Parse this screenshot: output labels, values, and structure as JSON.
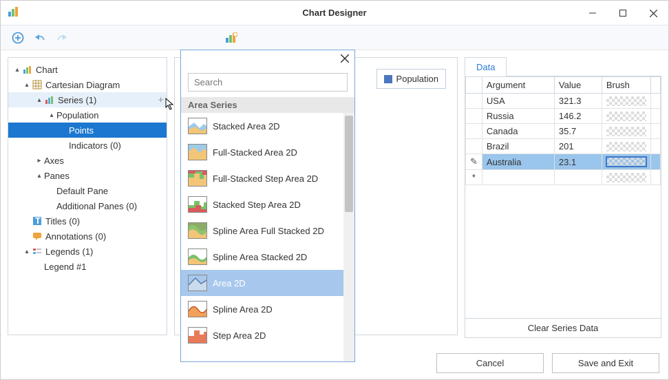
{
  "window": {
    "title": "Chart Designer"
  },
  "tree": {
    "root": "Chart",
    "diagram": "Cartesian Diagram",
    "series": "Series (1)",
    "population": "Population",
    "points": "Points",
    "indicators": "Indicators (0)",
    "axes": "Axes",
    "panes": "Panes",
    "default_pane": "Default Pane",
    "additional_panes": "Additional Panes (0)",
    "titles": "Titles (0)",
    "annotations": "Annotations (0)",
    "legends": "Legends (1)",
    "legend1": "Legend #1"
  },
  "legend": {
    "label": "Population"
  },
  "popup": {
    "search_placeholder": "Search",
    "group": "Area Series",
    "items": [
      "Stacked Area 2D",
      "Full-Stacked Area 2D",
      "Full-Stacked Step Area 2D",
      "Stacked Step Area 2D",
      "Spline Area Full Stacked 2D",
      "Spline Area Stacked 2D",
      "Area 2D",
      "Spline Area 2D",
      "Step Area 2D"
    ]
  },
  "data_tab": {
    "tab_label": "Data",
    "columns": [
      "Argument",
      "Value",
      "Brush"
    ],
    "rows": [
      {
        "arg": "USA",
        "val": "321.3"
      },
      {
        "arg": "Russia",
        "val": "146.2"
      },
      {
        "arg": "Canada",
        "val": "35.7"
      },
      {
        "arg": "Brazil",
        "val": "201"
      },
      {
        "arg": "Australia",
        "val": "23.1"
      }
    ],
    "clear": "Clear Series Data"
  },
  "footer": {
    "cancel": "Cancel",
    "save": "Save and Exit"
  },
  "chart_data": {
    "type": "table",
    "title": "Population",
    "columns": [
      "Argument",
      "Value"
    ],
    "rows": [
      [
        "USA",
        321.3
      ],
      [
        "Russia",
        146.2
      ],
      [
        "Canada",
        35.7
      ],
      [
        "Brazil",
        201
      ],
      [
        "Australia",
        23.1
      ]
    ]
  }
}
